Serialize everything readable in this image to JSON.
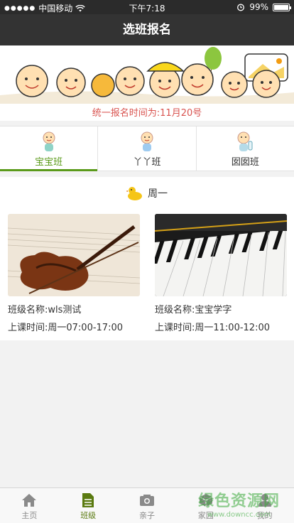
{
  "status_bar": {
    "carrier": "中国移动",
    "time": "下午7:18",
    "battery": "99%",
    "battery_level": 0.99
  },
  "nav": {
    "title": "选班报名"
  },
  "banner": {
    "registration_time": "统一报名时间为:11月20号"
  },
  "class_tabs": [
    {
      "label": "宝宝班",
      "active": true
    },
    {
      "label": "丫丫班",
      "active": false
    },
    {
      "label": "囡囡班",
      "active": false
    }
  ],
  "day": {
    "label": "周一"
  },
  "classes": [
    {
      "name": "班级名称:wls测试",
      "time": "上课时间:周一07:00-17:00",
      "image": "violin"
    },
    {
      "name": "班级名称:宝宝学字",
      "time": "上课时间:周一11:00-12:00",
      "image": "piano"
    }
  ],
  "tabbar": [
    {
      "label": "主页",
      "icon": "home-icon",
      "active": false
    },
    {
      "label": "班级",
      "icon": "document-icon",
      "active": true
    },
    {
      "label": "亲子",
      "icon": "camera-icon",
      "active": false
    },
    {
      "label": "家园",
      "icon": "cube-icon",
      "active": false
    },
    {
      "label": "我的",
      "icon": "user-icon",
      "active": false
    }
  ],
  "watermark": {
    "title": "绿色资源网",
    "url": "www.downcc.com"
  },
  "colors": {
    "accent": "#5a9a1a",
    "nav": "#333333",
    "notice": "#d9534f"
  }
}
